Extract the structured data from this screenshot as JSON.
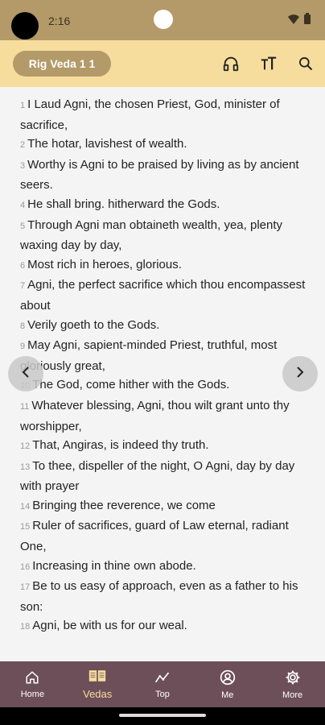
{
  "status": {
    "time": "2:16"
  },
  "header": {
    "title": "Rig Veda 1 1"
  },
  "verses": [
    {
      "num": "1",
      "text": "I Laud Agni, the chosen Priest, God, minister of sacrifice,"
    },
    {
      "num": "2",
      "text": "The hotar, lavishest of wealth."
    },
    {
      "num": "3",
      "text": "Worthy is Agni to be praised by living as by ancient seers."
    },
    {
      "num": "4",
      "text": "He shall bring. hitherward the Gods."
    },
    {
      "num": "5",
      "text": "Through Agni man obtaineth wealth, yea, plenty waxing day by day,"
    },
    {
      "num": "6",
      "text": "Most rich in heroes, glorious."
    },
    {
      "num": "7",
      "text": "Agni, the perfect sacrifice which thou encompassest about"
    },
    {
      "num": "8",
      "text": "Verily goeth to the Gods."
    },
    {
      "num": "9",
      "text": "May Agni, sapient-minded Priest, truthful, most gloriously great,"
    },
    {
      "num": "10",
      "text": "The God, come hither with the Gods."
    },
    {
      "num": "11",
      "text": "Whatever blessing, Agni, thou wilt grant unto thy worshipper,"
    },
    {
      "num": "12",
      "text": "That, Angiras, is indeed thy truth."
    },
    {
      "num": "13",
      "text": "To thee, dispeller of the night, O Agni, day by day with prayer"
    },
    {
      "num": "14",
      "text": "Bringing thee reverence, we come"
    },
    {
      "num": "15",
      "text": "Ruler of sacrifices, guard of Law eternal, radiant One,"
    },
    {
      "num": "16",
      "text": "Increasing in thine own abode."
    },
    {
      "num": "17",
      "text": "Be to us easy of approach, even as a father to his son:"
    },
    {
      "num": "18",
      "text": "Agni, be with us for our weal."
    }
  ],
  "bottom_nav": [
    {
      "label": "Home",
      "icon": "home-icon"
    },
    {
      "label": "Vedas",
      "icon": "book-icon"
    },
    {
      "label": "Top",
      "icon": "trending-icon"
    },
    {
      "label": "Me",
      "icon": "person-icon"
    },
    {
      "label": "More",
      "icon": "gear-icon"
    }
  ],
  "colors": {
    "status_bar": "#b39a68",
    "app_bar": "#f6dd9e",
    "bottom_nav": "#6d4f59",
    "active_nav": "#f6dd9e"
  }
}
